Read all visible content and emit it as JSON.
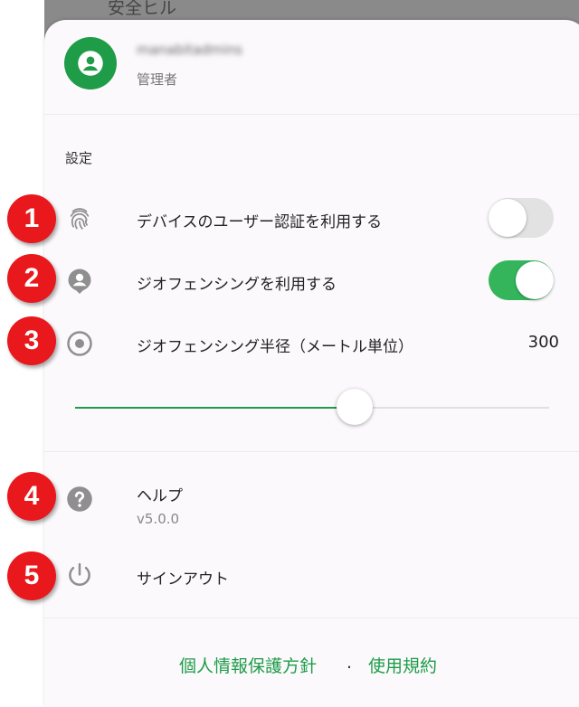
{
  "background": {
    "title": "安全ヒル"
  },
  "header": {
    "user_name": "manabitadmins",
    "role": "管理者",
    "avatar_icon": "person-circle-icon",
    "avatar_color": "#1e9c47"
  },
  "settings": {
    "title": "設定",
    "items": [
      {
        "label": "デバイスのユーザー認証を利用する",
        "icon": "fingerprint-icon",
        "toggle": false
      },
      {
        "label": "ジオフェンシングを利用する",
        "icon": "location-person-icon",
        "toggle": true
      },
      {
        "label": "ジオフェンシング半径（メートル単位）",
        "icon": "radio-target-icon",
        "value": "300"
      }
    ],
    "slider_fraction": 0.59
  },
  "help": {
    "label": "ヘルプ",
    "version": "v5.0.0",
    "icon": "help-circle-icon"
  },
  "signout": {
    "label": "サインアウト",
    "icon": "power-icon"
  },
  "footer": {
    "privacy": "個人情報保護方針",
    "separator": ".",
    "terms": "使用規約"
  },
  "badges": [
    "1",
    "2",
    "3",
    "4",
    "5"
  ],
  "colors": {
    "accent": "#1e9c47",
    "badge": "#e8181c",
    "toggle_on": "#34b55c"
  }
}
